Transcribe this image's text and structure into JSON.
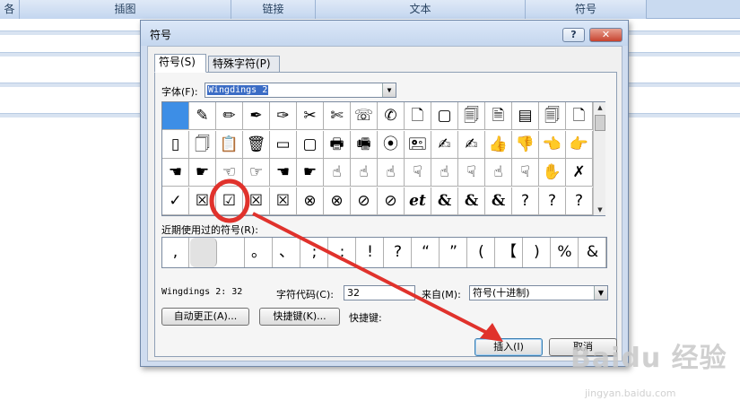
{
  "ribbon": {
    "tabs": [
      "各",
      "插图",
      "链接",
      "文本",
      "符号"
    ]
  },
  "dialog": {
    "title": "符号",
    "help_label": "?",
    "close_label": "✕",
    "tabs": [
      {
        "label": "符号(S)",
        "active": true
      },
      {
        "label": "特殊字符(P)",
        "active": false
      }
    ],
    "font_label": "字体(F):",
    "font_value": "Wingdings 2",
    "symbols": [
      [
        "",
        "✎",
        "✏",
        "✒",
        "✑",
        "✂",
        "✄",
        "☏",
        "✆",
        "🗋",
        "▢",
        "🗐",
        "🗎",
        "▤",
        "🗐",
        "🗋"
      ],
      [
        "▯",
        "🗍",
        "📋",
        "🗑",
        "▭",
        "▢",
        "🖶",
        "🖷",
        "⦿",
        "🖭",
        "✍",
        "✍",
        "👍",
        "👎",
        "👈",
        "👉"
      ],
      [
        "☚",
        "☛",
        "☜",
        "☞",
        "☚",
        "☛",
        "☝",
        "☝",
        "☝",
        "☟",
        "☝",
        "☟",
        "☝",
        "☟",
        "✋",
        "✗"
      ],
      [
        "✓",
        "☒",
        "☑",
        "☒",
        "☒",
        "⊗",
        "⊗",
        "⊘",
        "⊘",
        "et",
        "&",
        "&",
        "&",
        "?",
        "?",
        "?"
      ]
    ],
    "selected_index": [
      0,
      0
    ],
    "circled_index": [
      3,
      2
    ],
    "recent_label": "近期使用过的符号(R):",
    "recent": [
      ",",
      "",
      "",
      "。",
      "、",
      ";",
      ":",
      "!",
      "?",
      "“",
      "”",
      "(",
      "【",
      ")",
      "%",
      "&"
    ],
    "char_name": "Wingdings 2: 32",
    "code_label": "字符代码(C):",
    "code_value": "32",
    "from_label": "来自(M):",
    "from_value": "符号(十进制)",
    "autocorrect_label": "自动更正(A)...",
    "shortcut_btn_label": "快捷键(K)...",
    "shortcut_label": "快捷键:",
    "insert_label": "插入(I)",
    "cancel_label": "取消"
  },
  "annotation": {
    "color": "#e0322c"
  },
  "watermark": {
    "brand": "Baidu 经验",
    "url": "jingyan.baidu.com"
  }
}
